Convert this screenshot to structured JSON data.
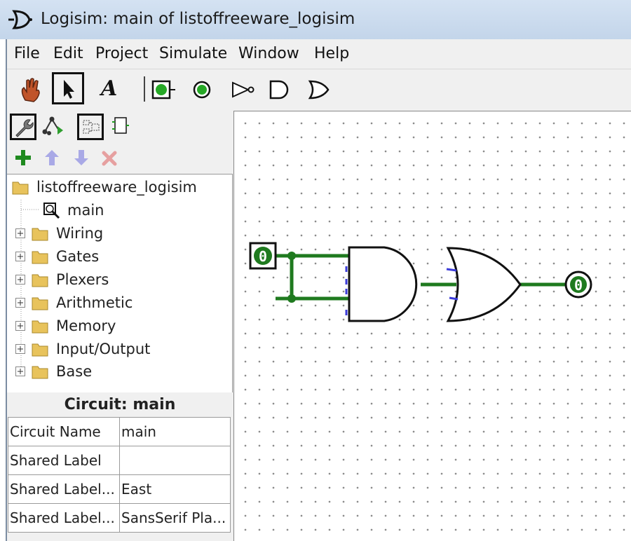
{
  "window": {
    "title": "Logisim: main of listoffreeware_logisim"
  },
  "menu": [
    "File",
    "Edit",
    "Project",
    "Simulate",
    "Window",
    "Help"
  ],
  "toolbar": {
    "tools": [
      "poke-tool",
      "select-tool",
      "text-tool",
      "input-pin",
      "output-pin",
      "not-gate",
      "and-gate",
      "or-gate"
    ],
    "text_tool_glyph": "A"
  },
  "tree": {
    "project": "listoffreeware_logisim",
    "circuit": "main",
    "libraries": [
      "Wiring",
      "Gates",
      "Plexers",
      "Arithmetic",
      "Memory",
      "Input/Output",
      "Base"
    ]
  },
  "attributes": {
    "title": "Circuit: main",
    "rows": [
      {
        "key": "Circuit Name",
        "value": "main"
      },
      {
        "key": "Shared Label",
        "value": ""
      },
      {
        "key": "Shared Label...",
        "value": "East"
      },
      {
        "key": "Shared Label...",
        "value": "SansSerif Pla..."
      }
    ]
  },
  "circuit": {
    "input_value": "0",
    "output_value": "0",
    "wire_color": "#1f7a1f"
  }
}
